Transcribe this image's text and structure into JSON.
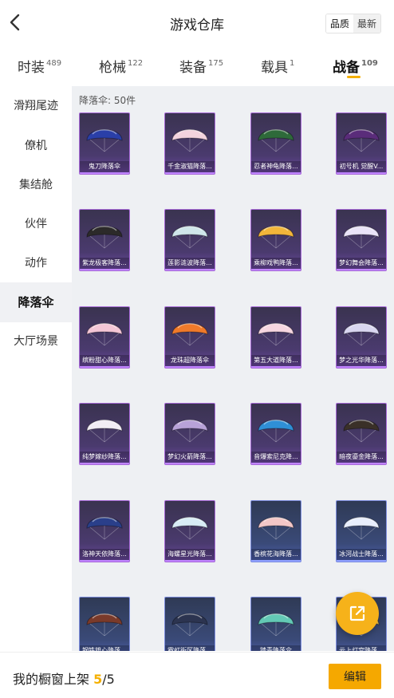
{
  "header": {
    "title": "游戏仓库",
    "sort_quality": "品质",
    "sort_latest": "最新"
  },
  "tabs": [
    {
      "label": "时装",
      "count": "489"
    },
    {
      "label": "枪械",
      "count": "122"
    },
    {
      "label": "装备",
      "count": "175"
    },
    {
      "label": "载具",
      "count": "1"
    },
    {
      "label": "战备",
      "count": "109",
      "active": true
    }
  ],
  "sidebar": {
    "items": [
      {
        "label": "滑翔尾迹"
      },
      {
        "label": "僚机"
      },
      {
        "label": "集结舱"
      },
      {
        "label": "伙伴"
      },
      {
        "label": "动作"
      },
      {
        "label": "降落伞",
        "active": true
      },
      {
        "label": "大厅场景"
      }
    ]
  },
  "content": {
    "count_label": "降落伞: 50件"
  },
  "items": [
    {
      "name": "鬼刀降落伞",
      "color": "#2a3fa8",
      "rarity": "purple"
    },
    {
      "name": "千金淑猫降落...",
      "color": "#f3d3de",
      "rarity": "purple"
    },
    {
      "name": "忍者神龟降落...",
      "color": "#2e6a3a",
      "rarity": "purple"
    },
    {
      "name": "初号机 觉醒V...",
      "color": "#5a2c7a",
      "rarity": "purple"
    },
    {
      "name": "紫龙极客降落...",
      "color": "#2c2a2a",
      "rarity": "purple"
    },
    {
      "name": "莲影涟波降落...",
      "color": "#cfe6ea",
      "rarity": "purple"
    },
    {
      "name": "乘柳戏鸭降落...",
      "color": "#f2b63a",
      "rarity": "purple"
    },
    {
      "name": "梦幻舞会降落...",
      "color": "#e9e3f7",
      "rarity": "purple"
    },
    {
      "name": "缤粉甜心降落...",
      "color": "#f4c6d6",
      "rarity": "purple"
    },
    {
      "name": "龙珠超降落伞",
      "color": "#f07a2a",
      "rarity": "purple"
    },
    {
      "name": "第五大道降落...",
      "color": "#f6d6e0",
      "rarity": "purple"
    },
    {
      "name": "梦之光华降落...",
      "color": "#d9d6f0",
      "rarity": "purple"
    },
    {
      "name": "纯梦嫁纱降落...",
      "color": "#f1edf4",
      "rarity": "purple"
    },
    {
      "name": "梦幻火箭降落...",
      "color": "#b8a2d8",
      "rarity": "purple"
    },
    {
      "name": "音爆索尼克降...",
      "color": "#2f8fd6",
      "rarity": "purple"
    },
    {
      "name": "暗夜鎏金降落...",
      "color": "#3a3028",
      "rarity": "purple"
    },
    {
      "name": "洛神天依降落...",
      "color": "#2a3f8a",
      "rarity": "purple"
    },
    {
      "name": "海螺星光降落...",
      "color": "#d8ecf5",
      "rarity": "purple"
    },
    {
      "name": "香槟花海降落...",
      "color": "#f3c7c7",
      "rarity": "blue"
    },
    {
      "name": "冰河战士降落...",
      "color": "#e8eefc",
      "rarity": "blue"
    },
    {
      "name": "钢铁雄心降落...",
      "color": "#7a3a2a",
      "rarity": "blue"
    },
    {
      "name": "霓虹街区降落...",
      "color": "#2c3450",
      "rarity": "blue"
    },
    {
      "name": "踏青降落伞",
      "color": "#63c9b5",
      "rarity": "blue"
    },
    {
      "name": "云上灯宫降落...",
      "color": "#f0c24c",
      "rarity": "blue"
    }
  ],
  "footer": {
    "shelf_prefix": "我的橱窗上架",
    "shelf_current": "5",
    "shelf_total": "/5",
    "edit_label": "编辑"
  },
  "icons": {
    "back": "chevron-left-icon",
    "share": "share-external-icon"
  },
  "colors": {
    "accent": "#f5b000",
    "content_bg": "#eef0f3"
  }
}
